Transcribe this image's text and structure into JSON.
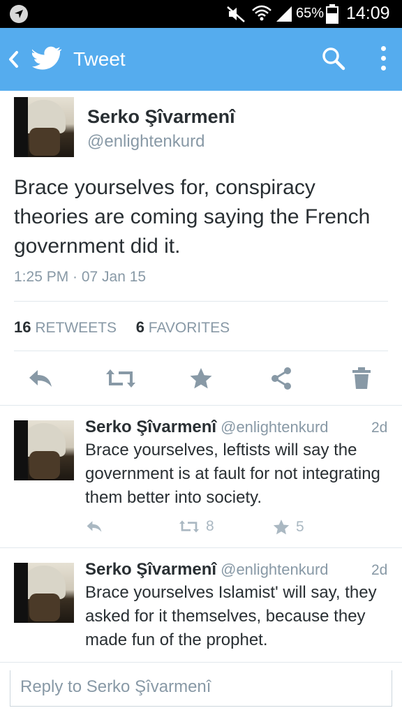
{
  "status_bar": {
    "battery": "65%",
    "time": "14:09"
  },
  "app_bar": {
    "title": "Tweet"
  },
  "tweet": {
    "name": "Serko Şîvarmenî",
    "handle": "@enlightenkurd",
    "text": "Brace yourselves for, conspiracy theories are coming saying the French government did it.",
    "timestamp": "1:25 PM · 07 Jan 15",
    "retweets_count": "16",
    "retweets_label": "RETWEETS",
    "favorites_count": "6",
    "favorites_label": "FAVORITES"
  },
  "replies": [
    {
      "name": "Serko Şîvarmenî",
      "handle": "@enlightenkurd",
      "time": "2d",
      "text": "Brace yourselves, leftists will say the government is at fault for not integrating them better into society.",
      "retweets": "8",
      "favorites": "5"
    },
    {
      "name": "Serko Şîvarmenî",
      "handle": "@enlightenkurd",
      "time": "2d",
      "text": "Brace yourselves Islamist' will say, they asked for it themselves, because they made fun of the prophet."
    }
  ],
  "reply_box": {
    "placeholder": "Reply to Serko Şîvarmenî"
  },
  "colors": {
    "accent": "#55acee",
    "muted": "#8899a6",
    "text": "#292f33"
  }
}
